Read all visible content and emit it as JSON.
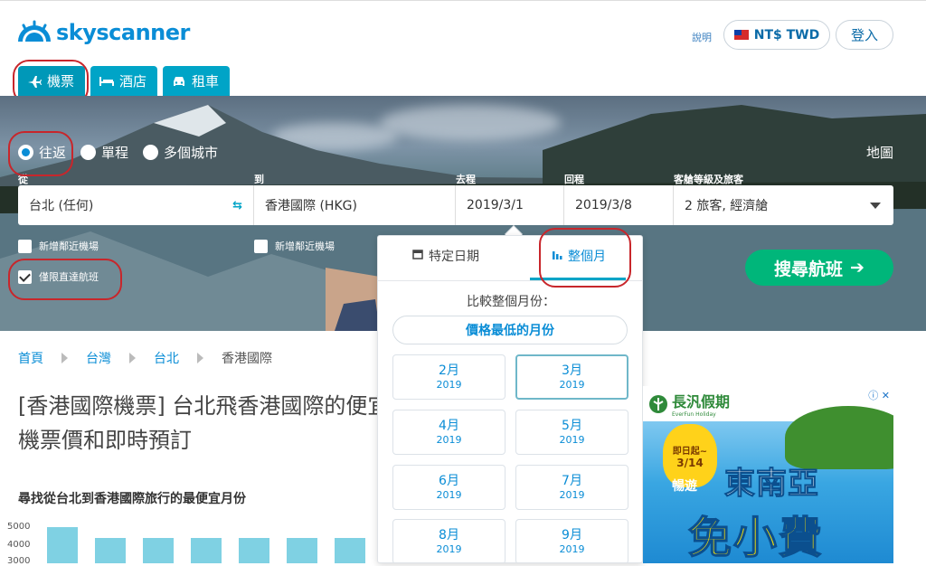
{
  "header": {
    "brand": "skyscanner",
    "help": "說明",
    "currency": "NT$ TWD",
    "login": "登入"
  },
  "tabs": [
    {
      "label": "機票",
      "icon": "plane-icon"
    },
    {
      "label": "酒店",
      "icon": "bed-icon"
    },
    {
      "label": "租車",
      "icon": "car-icon"
    }
  ],
  "trip_type": {
    "options": [
      "往返",
      "單程",
      "多個城市"
    ],
    "selected": "往返"
  },
  "map_link": "地圖",
  "search": {
    "from_label": "從",
    "from_value": "台北 (任何)",
    "to_label": "到",
    "to_value": "香港國際 (HKG)",
    "depart_label": "去程",
    "depart_value": "2019/3/1",
    "return_label": "回程",
    "return_value": "2019/3/8",
    "cabin_label": "客艙等級及旅客",
    "cabin_value": "2 旅客, 經濟艙",
    "nearby_from": "新增鄰近機場",
    "nearby_to": "新增鄰近機場",
    "direct_only": "僅限直達航班",
    "button": "搜尋航班"
  },
  "date_picker": {
    "tab_specific": "特定日期",
    "tab_whole_month": "整個月",
    "compare_label": "比較整個月份：",
    "cheapest_label": "價格最低的月份",
    "months": [
      {
        "name": "2月",
        "year": "2019"
      },
      {
        "name": "3月",
        "year": "2019"
      },
      {
        "name": "4月",
        "year": "2019"
      },
      {
        "name": "5月",
        "year": "2019"
      },
      {
        "name": "6月",
        "year": "2019"
      },
      {
        "name": "7月",
        "year": "2019"
      },
      {
        "name": "8月",
        "year": "2019"
      },
      {
        "name": "9月",
        "year": "2019"
      }
    ],
    "selected_month": "3月"
  },
  "breadcrumb": [
    "首頁",
    "台灣",
    "台北",
    "香港國際"
  ],
  "page_title": "[香港國際機票] 台北飛香港國際的便宜機票價和即時預訂",
  "chart_data": {
    "type": "bar",
    "title": "尋找從台北到香港國際旅行的最便宜月份",
    "y_ticks": [
      "5000",
      "4000",
      "3000"
    ],
    "values": [
      5000,
      4400,
      4400,
      4400,
      4400,
      4400,
      4400
    ],
    "ylim": [
      3000,
      5000
    ]
  },
  "ad": {
    "brand": "長汎假期",
    "brand_sub": "EverFun Holiday",
    "badge_top": "即日起~",
    "badge_date": "3/14",
    "line1": "暢遊",
    "line2": "東南亞",
    "line3": "免小費"
  },
  "colors": {
    "brand_blue": "#0a8dd6",
    "tab_teal": "#00a4c7",
    "search_green": "#00b67a",
    "annotation_red": "#c8262b"
  }
}
